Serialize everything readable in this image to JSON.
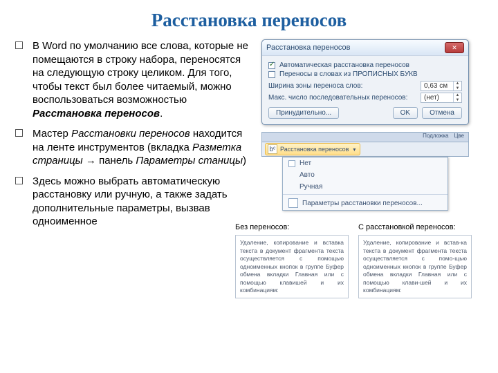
{
  "title": "Расстановка переносов",
  "bullets": [
    {
      "pre": "В Word по умолчанию все слова, которые не помещаются в строку набора, переносятся на следующую строку целиком. Для того, чтобы текст был более читаемый, можно воспользоваться возможностью ",
      "em": "Расстановка переносов",
      "post": "."
    },
    {
      "pre": "Мастер ",
      "em1": "Расстановки переносов",
      "mid": " находится на ленте инструментов (вкладка ",
      "em2": "Разметка страницы",
      "arrow": " → панель ",
      "em3": "Параметры станицы",
      "post": ")"
    },
    {
      "text": "Здесь можно выбрать автоматическую расстановку или ручную, а также задать дополнительные параметры, вызвав одноименное"
    }
  ],
  "dialog": {
    "title": "Расстановка переносов",
    "close": "✕",
    "chk_auto": "Автоматическая расстановка переносов",
    "chk_caps": "Переносы в словах из ПРОПИСНЫХ БУКВ",
    "row_zone": "Ширина зоны переноса слов:",
    "row_zone_val": "0,63 см",
    "row_max": "Макс. число последовательных переносов:",
    "row_max_val": "(нет)",
    "btn_force": "Принудительно...",
    "btn_ok": "OK",
    "btn_cancel": "Отмена"
  },
  "ribbon": {
    "tabs": [
      "Подложка",
      "Цве"
    ],
    "btn": "Расстановка переносов",
    "dd_none": "Нет",
    "dd_auto": "Авто",
    "dd_manual": "Ручная",
    "dd_opts": "Параметры расстановки переносов..."
  },
  "samples": {
    "left_label": "Без переносов:",
    "right_label": "С расстановкой переносов:",
    "left_text": "Удаление, копирование и вставка текста в документ фрагмента текста осуществляется с помощью одноименных кнопок в группе Буфер обмена вкладки Главная или с помощью клавишей и их комбинациям:",
    "right_text": "Удаление, копирование и встав-ка текста в документ фрагмента текста осуществляется с помо-щью одноименных кнопок в группе Буфер обмена вкладки Главная или с помощью клави-шей и их комбинациям:"
  }
}
